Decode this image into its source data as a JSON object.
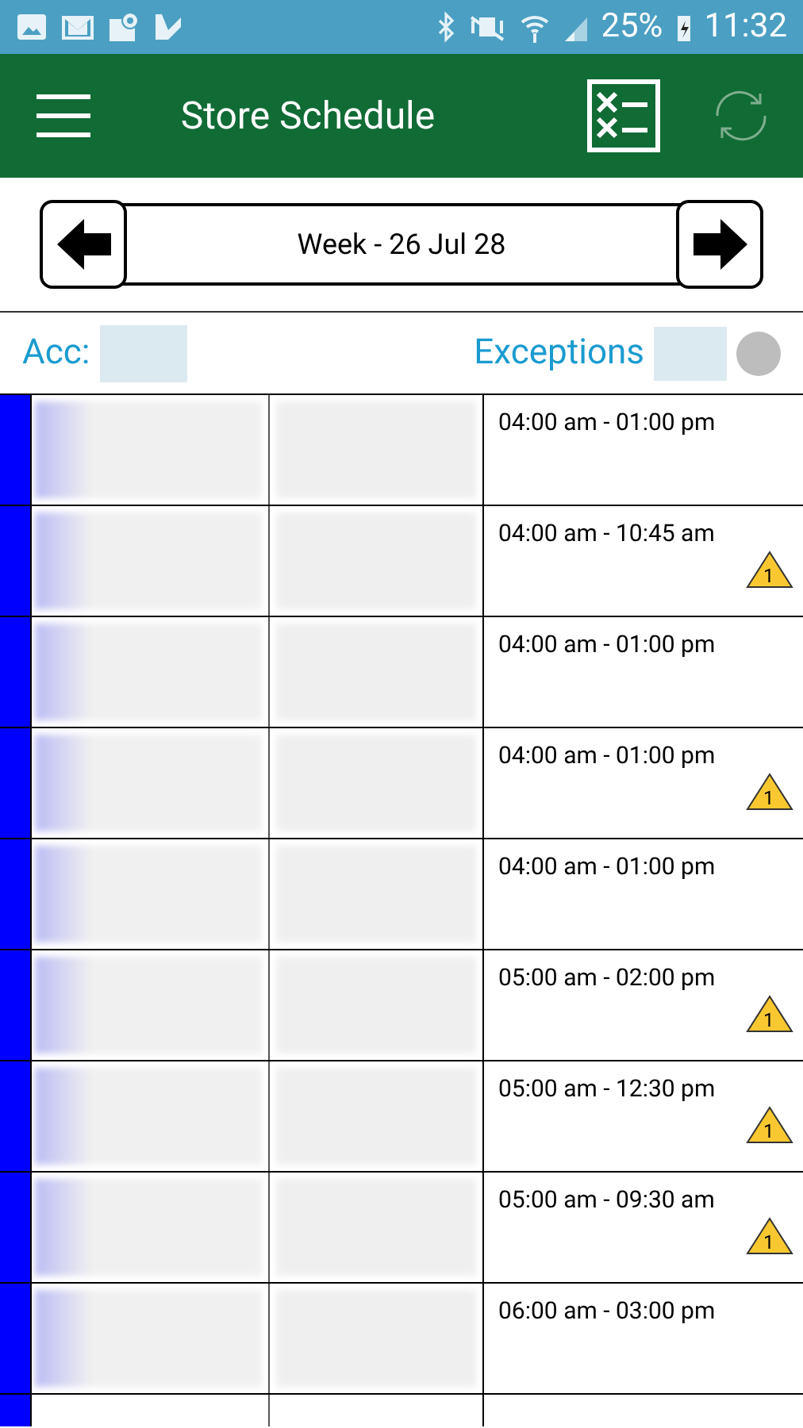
{
  "status_bar": {
    "battery": "25%",
    "time": "11:32"
  },
  "app_bar": {
    "title": "Store Schedule"
  },
  "week_nav": {
    "label": "Week - 26 Jul 28"
  },
  "filter_bar": {
    "account_label": "Acc:",
    "exceptions_label": "Exceptions",
    "exceptions_on": false
  },
  "rows": [
    {
      "time": "04:00 am - 01:00 pm",
      "warning": false
    },
    {
      "time": "04:00 am - 10:45 am",
      "warning": true,
      "warning_count": "1"
    },
    {
      "time": "04:00 am - 01:00 pm",
      "warning": false
    },
    {
      "time": "04:00 am - 01:00 pm",
      "warning": true,
      "warning_count": "1"
    },
    {
      "time": "04:00 am - 01:00 pm",
      "warning": false
    },
    {
      "time": "05:00 am - 02:00 pm",
      "warning": true,
      "warning_count": "1"
    },
    {
      "time": "05:00 am - 12:30 pm",
      "warning": true,
      "warning_count": "1"
    },
    {
      "time": "05:00 am - 09:30 am",
      "warning": true,
      "warning_count": "1"
    },
    {
      "time": "06:00 am - 03:00 pm",
      "warning": false
    }
  ]
}
